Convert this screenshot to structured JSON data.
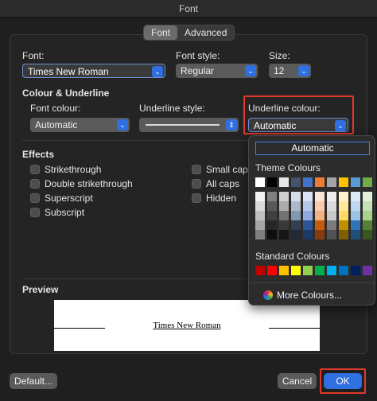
{
  "window": {
    "title": "Font"
  },
  "tabs": [
    {
      "label": "Font",
      "active": true
    },
    {
      "label": "Advanced",
      "active": false
    }
  ],
  "font": {
    "label": "Font:",
    "value": "Times New Roman"
  },
  "font_style": {
    "label": "Font style:",
    "value": "Regular"
  },
  "size": {
    "label": "Size:",
    "value": "12"
  },
  "colour_underline": {
    "heading": "Colour & Underline",
    "font_colour_label": "Font colour:",
    "font_colour_value": "Automatic",
    "underline_style_label": "Underline style:",
    "underline_colour_label": "Underline colour:",
    "underline_colour_value": "Automatic"
  },
  "effects": {
    "heading": "Effects",
    "left": [
      "Strikethrough",
      "Double strikethrough",
      "Superscript",
      "Subscript"
    ],
    "right": [
      "Small caps",
      "All caps",
      "Hidden"
    ]
  },
  "preview": {
    "heading": "Preview",
    "sample": "Times New Roman"
  },
  "buttons": {
    "default": "Default...",
    "cancel": "Cancel",
    "ok": "OK"
  },
  "colour_popup": {
    "automatic": "Automatic",
    "theme_heading": "Theme Colours",
    "standard_heading": "Standard Colours",
    "more": "More Colours...",
    "theme_top": [
      "#ffffff",
      "#000000",
      "#e7e6e6",
      "#44546a",
      "#4472c4",
      "#ed7d31",
      "#a5a5a5",
      "#ffc000",
      "#5b9bd5",
      "#70ad47"
    ],
    "theme_shades": [
      [
        "#f2f2f2",
        "#808080",
        "#d0cece",
        "#d6dce5",
        "#dae3f3",
        "#fbe5d6",
        "#ededed",
        "#fff2cc",
        "#deebf7",
        "#e2f0d9"
      ],
      [
        "#d9d9d9",
        "#595959",
        "#aeabab",
        "#adb9ca",
        "#b4c7e7",
        "#f8cbad",
        "#dbdbdb",
        "#ffe699",
        "#bdd7ee",
        "#c5e0b4"
      ],
      [
        "#bfbfbf",
        "#404040",
        "#767171",
        "#8497b0",
        "#8faadc",
        "#f4b183",
        "#c9c9c9",
        "#ffd966",
        "#9dc3e6",
        "#a9d18e"
      ],
      [
        "#a6a6a6",
        "#262626",
        "#3b3838",
        "#333f50",
        "#2f5597",
        "#c55a11",
        "#7b7b7b",
        "#bf9000",
        "#2e75b6",
        "#548235"
      ],
      [
        "#7f7f7f",
        "#0d0d0d",
        "#171616",
        "#222a35",
        "#203864",
        "#843c0c",
        "#525252",
        "#7f6000",
        "#1f4e79",
        "#385723"
      ]
    ],
    "standard": [
      "#c00000",
      "#ff0000",
      "#ffc000",
      "#ffff00",
      "#92d050",
      "#00b050",
      "#00b0f0",
      "#0070c0",
      "#002060",
      "#7030a0"
    ]
  },
  "colors": {
    "accent": "#2f6fe0",
    "highlight": "#e0392b"
  }
}
